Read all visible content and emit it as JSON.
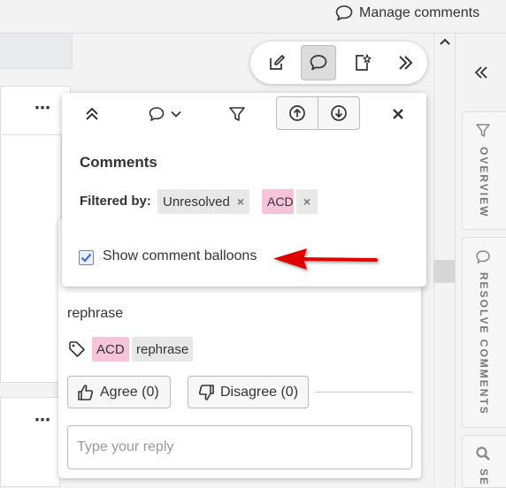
{
  "topbar": {
    "manage_comments_label": "Manage comments",
    "manage_comments_icon": "comment-icon"
  },
  "colors": {
    "accent": "#5b8bd8",
    "tag_pink": "#f6c3d8",
    "chip_grey": "#e8e8e8",
    "annotation_red": "#e00000"
  },
  "toolbar": {
    "icons": [
      "edit-icon",
      "comment-icon",
      "suggest-icon",
      "expand-icon"
    ],
    "active": "comment-icon"
  },
  "comments_panel": {
    "title": "Comments",
    "filter_label": "Filtered by:",
    "filters": [
      {
        "label": "Unresolved",
        "remove": "×"
      },
      {
        "label": "ACD",
        "remove": "×"
      }
    ],
    "show_balloons_label": "Show comment balloons",
    "show_balloons_checked": true
  },
  "comment_card": {
    "text": "rephrase",
    "tags": [
      "ACD",
      "rephrase"
    ],
    "agree_label": "Agree (0)",
    "disagree_label": "Disagree (0)",
    "reply_placeholder": "Type your reply"
  },
  "sidebar": {
    "tabs": [
      {
        "label": "OVERVIEW",
        "icon": "filter-icon"
      },
      {
        "label": "RESOLVE COMMENTS",
        "icon": "comment-icon"
      },
      {
        "label": "SE",
        "icon": "search-icon"
      }
    ]
  }
}
